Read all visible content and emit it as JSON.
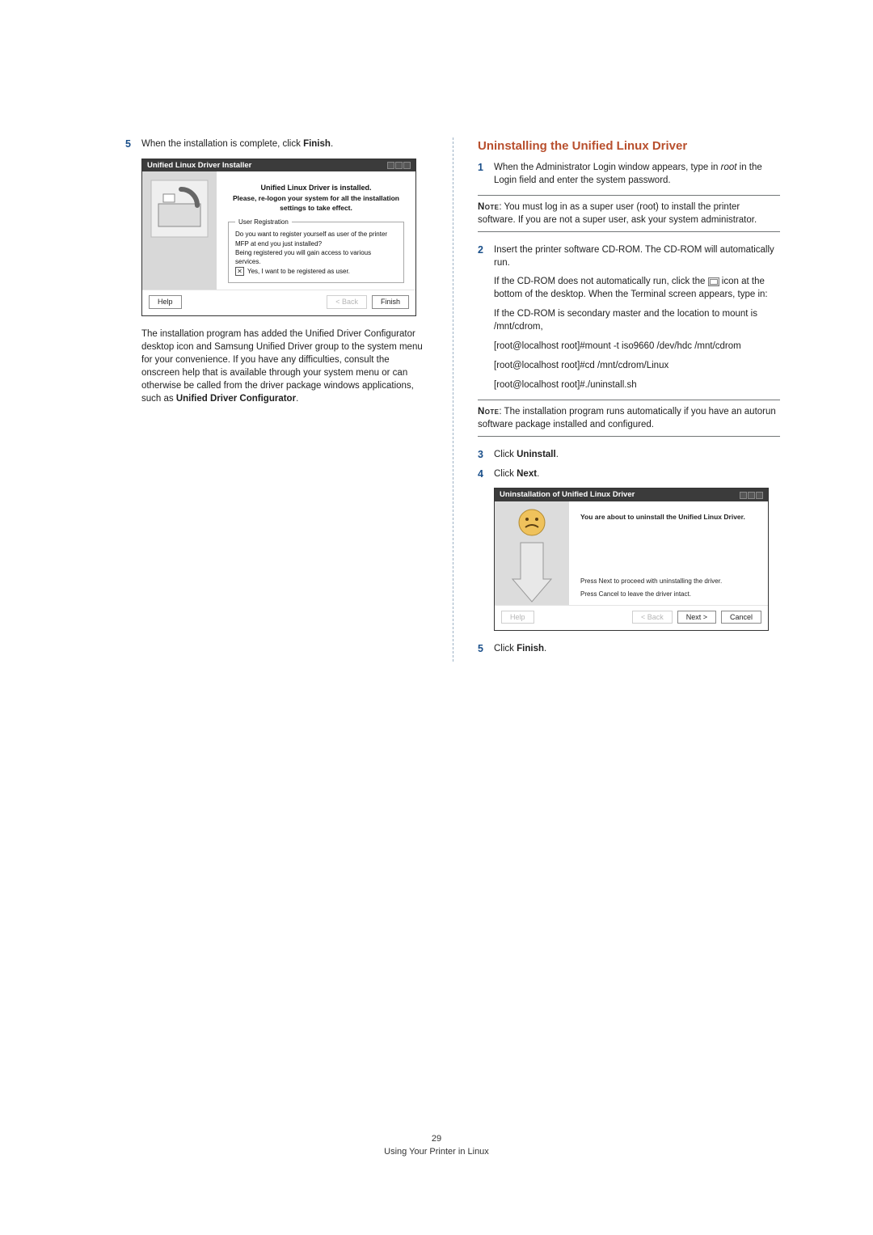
{
  "left": {
    "step5": {
      "prefix": "When the installation is complete, click ",
      "bold": "Finish",
      "suffix": "."
    },
    "installer": {
      "title": "Unified Linux Driver Installer",
      "heading": "Unified Linux Driver is installed.",
      "sub": "Please, re-logon your system for all the installation settings to take effect.",
      "legend": "User Registration",
      "q": "Do you want to register yourself as user of the printer MFP at end you just installed?",
      "benefit": "Being registered you will gain access to various services.",
      "checkbox": "Yes, I want to be registered as user.",
      "btn_help": "Help",
      "btn_back": "< Back",
      "btn_finish": "Finish"
    },
    "desc_a": "The installation program has added the Unified Driver Configurator desktop icon and Samsung Unified Driver group to the system menu for your convenience. If you have any difficulties, consult the onscreen help that is available through your system menu or can otherwise be called from the driver package windows applications, such as ",
    "desc_b": "Unified Driver Configurator",
    "desc_c": "."
  },
  "right": {
    "title": "Uninstalling the Unified Linux Driver",
    "step1": {
      "a": "When the Administrator Login window appears, type in ",
      "root": "root",
      "b": " in the Login field and enter the system password."
    },
    "note1": {
      "label": "Note",
      "text": ": You must log in as a super user (root) to install the printer software. If you are not a super user, ask your system administrator."
    },
    "step2": {
      "text": "Insert the printer software CD-ROM. The CD-ROM will automatically run."
    },
    "sub1_a": "If the CD-ROM does not automatically run, click the ",
    "sub1_b": " icon at the bottom of the desktop. When the Terminal screen appears, type in:",
    "sub2": "If the CD-ROM is secondary master and the location to mount is /mnt/cdrom,",
    "cmd1": "[root@localhost root]#mount -t iso9660 /dev/hdc /mnt/cdrom",
    "cmd2": "[root@localhost root]#cd /mnt/cdrom/Linux",
    "cmd3": "[root@localhost root]#./uninstall.sh",
    "note2": {
      "label": "Note",
      "text": ": The installation program runs automatically if you have an autorun software package installed and configured."
    },
    "step3": {
      "prefix": "Click ",
      "bold": "Uninstall",
      "suffix": "."
    },
    "step4": {
      "prefix": "Click ",
      "bold": "Next",
      "suffix": "."
    },
    "uninstaller": {
      "title": "Uninstallation of Unified Linux Driver",
      "line1": "You are about to uninstall the Unified Linux Driver.",
      "line2": "Press Next to proceed with uninstalling the driver.",
      "line3": "Press Cancel to leave the driver intact.",
      "btn_help": "Help",
      "btn_back": "< Back",
      "btn_next": "Next >",
      "btn_cancel": "Cancel"
    },
    "step5": {
      "prefix": "Click ",
      "bold": "Finish",
      "suffix": "."
    }
  },
  "footer": {
    "page_no": "29",
    "caption": "Using Your Printer in Linux"
  }
}
